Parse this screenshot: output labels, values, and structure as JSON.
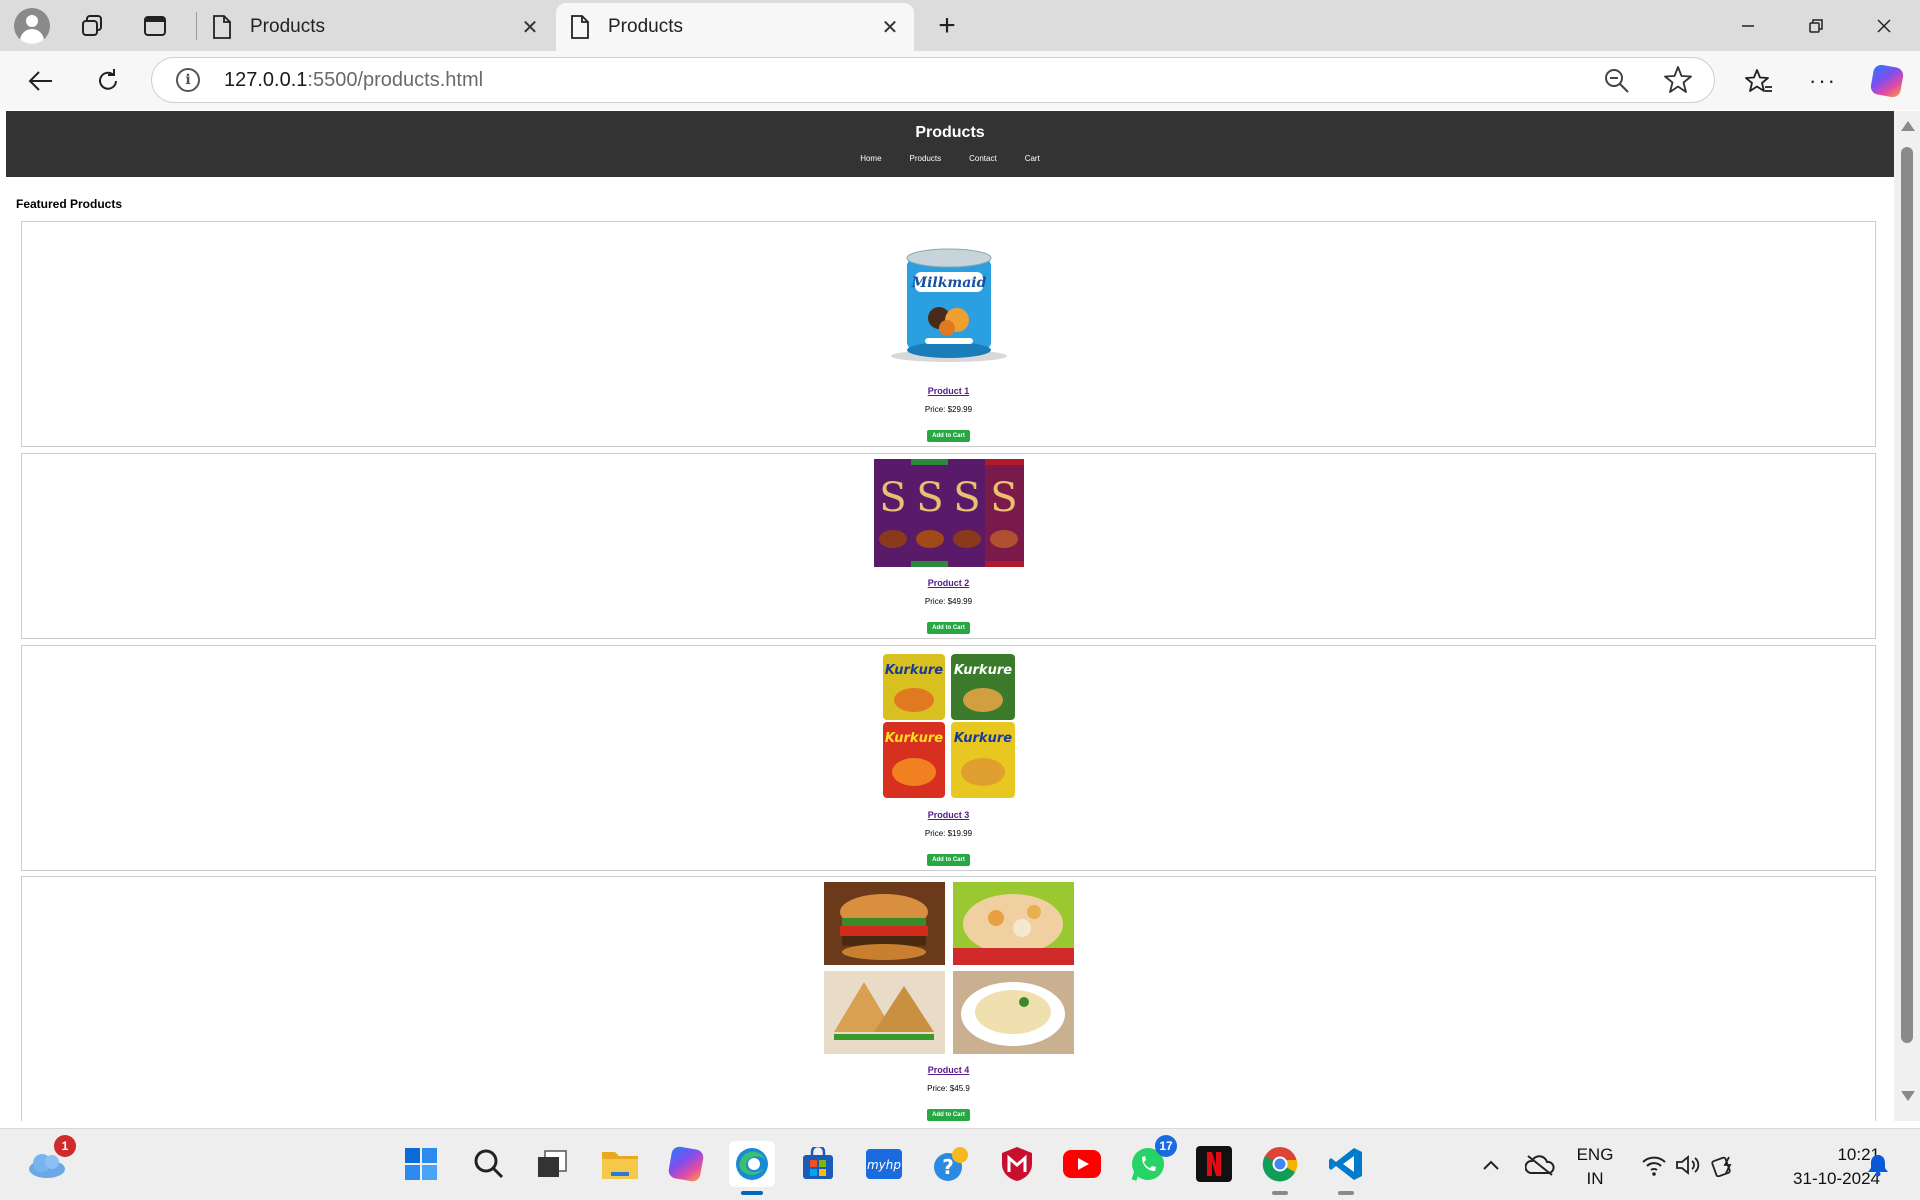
{
  "browser": {
    "tabs": [
      {
        "title": "Products"
      },
      {
        "title": "Products"
      }
    ],
    "url_host": "127.0.0.1",
    "url_rest": ":5500/products.html"
  },
  "site": {
    "title": "Products",
    "nav": [
      "Home",
      "Products",
      "Contact",
      "Cart"
    ],
    "section_title": "Featured Products",
    "products": [
      {
        "name": "Product 1",
        "price": "Price: $29.99",
        "button": "Add to Cart",
        "image": "Milkmaid condensed milk tin"
      },
      {
        "name": "Product 2",
        "price": "Price: $49.99",
        "button": "Add to Cart",
        "image": "Four Dairy Milk Silk chocolate bars"
      },
      {
        "name": "Product 3",
        "price": "Price: $19.99",
        "button": "Add to Cart",
        "image": "Four Kurkure snack packets"
      },
      {
        "name": "Product 4",
        "price": "Price: $45.9",
        "button": "Add to Cart",
        "image": "Food collage: burger, snacks, samosa, pasta"
      }
    ]
  },
  "taskbar": {
    "weather_badge": "1",
    "whatsapp_badge": "17",
    "lang_line1": "ENG",
    "lang_line2": "IN",
    "time": "10:21",
    "date": "31-10-2024"
  },
  "colors": {
    "header_bg": "#333333",
    "add_button": "#28a745",
    "link": "#551a8b"
  }
}
